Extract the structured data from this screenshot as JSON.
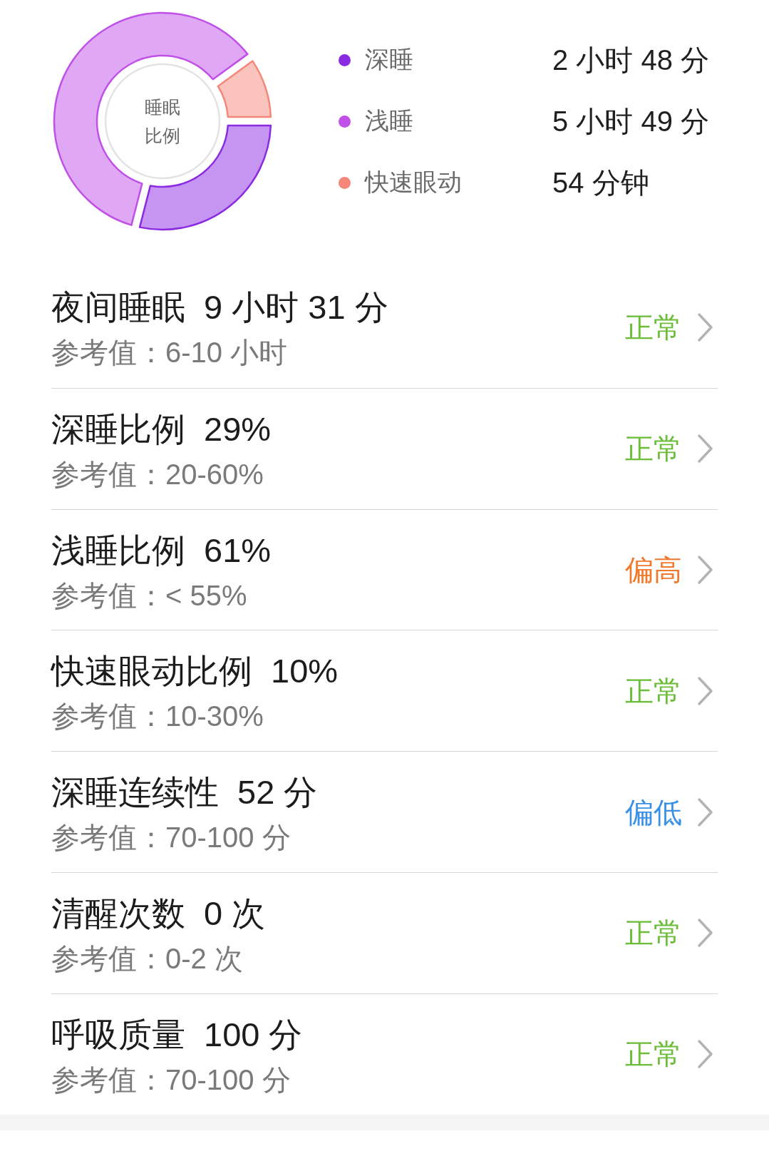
{
  "sleep_chart": {
    "chart_data": {
      "type": "donut",
      "title": "睡眠比例",
      "values": [
        29,
        61,
        10
      ]
    },
    "legend": [
      {
        "label": "深睡",
        "value": "2 小时 48 分",
        "color": "#8a2be2"
      },
      {
        "label": "浅睡",
        "value": "5 小时 49 分",
        "color": "#c050e8"
      },
      {
        "label": "快速眼动",
        "value": "54 分钟",
        "color": "#f5877a"
      }
    ]
  },
  "metrics": [
    {
      "name": "夜间睡眠",
      "value": "9 小时 31 分",
      "reference": "参考值：6-10 小时",
      "status": "正常",
      "color": "#6bbd3a"
    },
    {
      "name": "深睡比例",
      "value": "29%",
      "reference": "参考值：20-60%",
      "status": "正常",
      "color": "#6bbd3a"
    },
    {
      "name": "浅睡比例",
      "value": "61%",
      "reference": "参考值：< 55%",
      "status": "偏高",
      "color": "#f2782b"
    },
    {
      "name": "快速眼动比例",
      "value": "10%",
      "reference": "参考值：10-30%",
      "status": "正常",
      "color": "#6bbd3a"
    },
    {
      "name": "深睡连续性",
      "value": "52 分",
      "reference": "参考值：70-100 分",
      "status": "偏低",
      "color": "#3b91e6"
    },
    {
      "name": "清醒次数",
      "value": "0 次",
      "reference": "参考值：0-2 次",
      "status": "正常",
      "color": "#6bbd3a"
    },
    {
      "name": "呼吸质量",
      "value": "100 分",
      "reference": "参考值：70-100 分",
      "status": "正常",
      "color": "#6bbd3a"
    }
  ]
}
